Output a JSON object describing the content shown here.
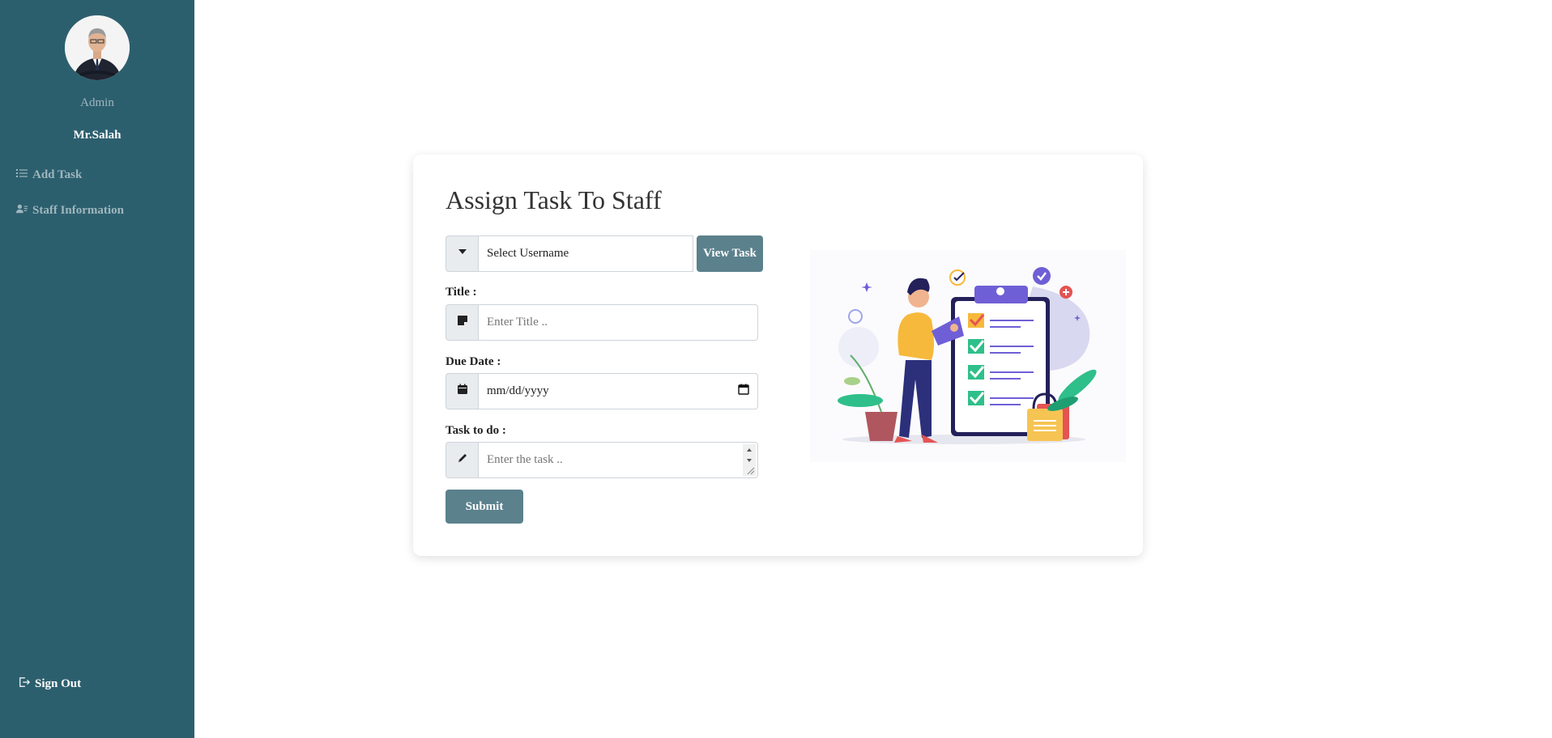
{
  "sidebar": {
    "role": "Admin",
    "user_name": "Mr.Salah",
    "items": [
      {
        "label": "Add Task",
        "icon": "list-icon"
      },
      {
        "label": "Staff Information",
        "icon": "user-card-icon"
      }
    ],
    "signout_label": "Sign Out"
  },
  "form": {
    "title": "Assign Task To Staff",
    "select_placeholder": "Select Username",
    "view_button": "View Task",
    "title_label": "Title :",
    "title_placeholder": "Enter Title ..",
    "due_label": "Due Date :",
    "due_placeholder": "mm/dd/yyyy",
    "task_label": "Task to do :",
    "task_placeholder": "Enter the task ..",
    "submit_label": "Submit"
  },
  "colors": {
    "sidebar_bg": "#2c5f6e",
    "button_bg": "#5b818d"
  }
}
